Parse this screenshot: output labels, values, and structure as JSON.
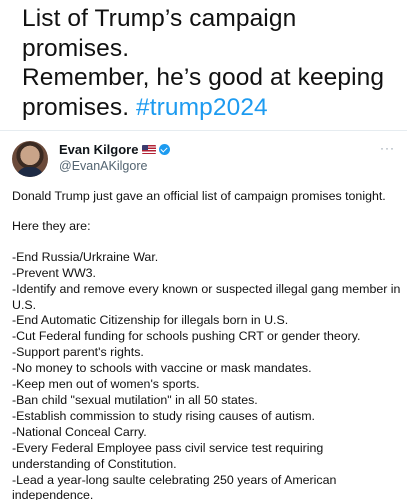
{
  "outer_post": {
    "lines": [
      "List of Trump’s campaign",
      "promises.",
      "Remember, he’s good at keeping"
    ],
    "last_line_text": "promises.",
    "hashtag": "#trump2024"
  },
  "embedded_tweet": {
    "display_name": "Evan Kilgore",
    "handle": "@EvanAKilgore",
    "more_label": "···",
    "intro": "Donald Trump just gave an official list of campaign promises tonight.",
    "here_they_are": "Here they are:",
    "promises": [
      "-End Russia/Urkraine War.",
      "-Prevent WW3.",
      "-Identify and remove every known or suspected illegal gang member in U.S.",
      "-End Automatic Citizenship for illegals born in U.S.",
      "-Cut Federal funding for schools pushing CRT or gender theory.",
      "-Support parent's rights.",
      "-No money to schools with vaccine or mask mandates.",
      "-Keep men out of women's sports.",
      "-Ban child \"sexual mutilation\" in all 50 states.",
      "-Establish commission to study rising causes of autism.",
      "-National Conceal Carry.",
      "-Every Federal Employee pass civil service test requiring understanding of Constitution.",
      "-Lead a year-long saulte celebrating 250 years of American independence."
    ]
  },
  "icons": {
    "flag": "us-flag-icon",
    "verified": "verified-badge-icon",
    "more": "more-options-icon"
  },
  "colors": {
    "hashtag": "#1d9bf0",
    "verified": "#1d9bf0",
    "handle": "#536471",
    "text": "#0f1419"
  }
}
